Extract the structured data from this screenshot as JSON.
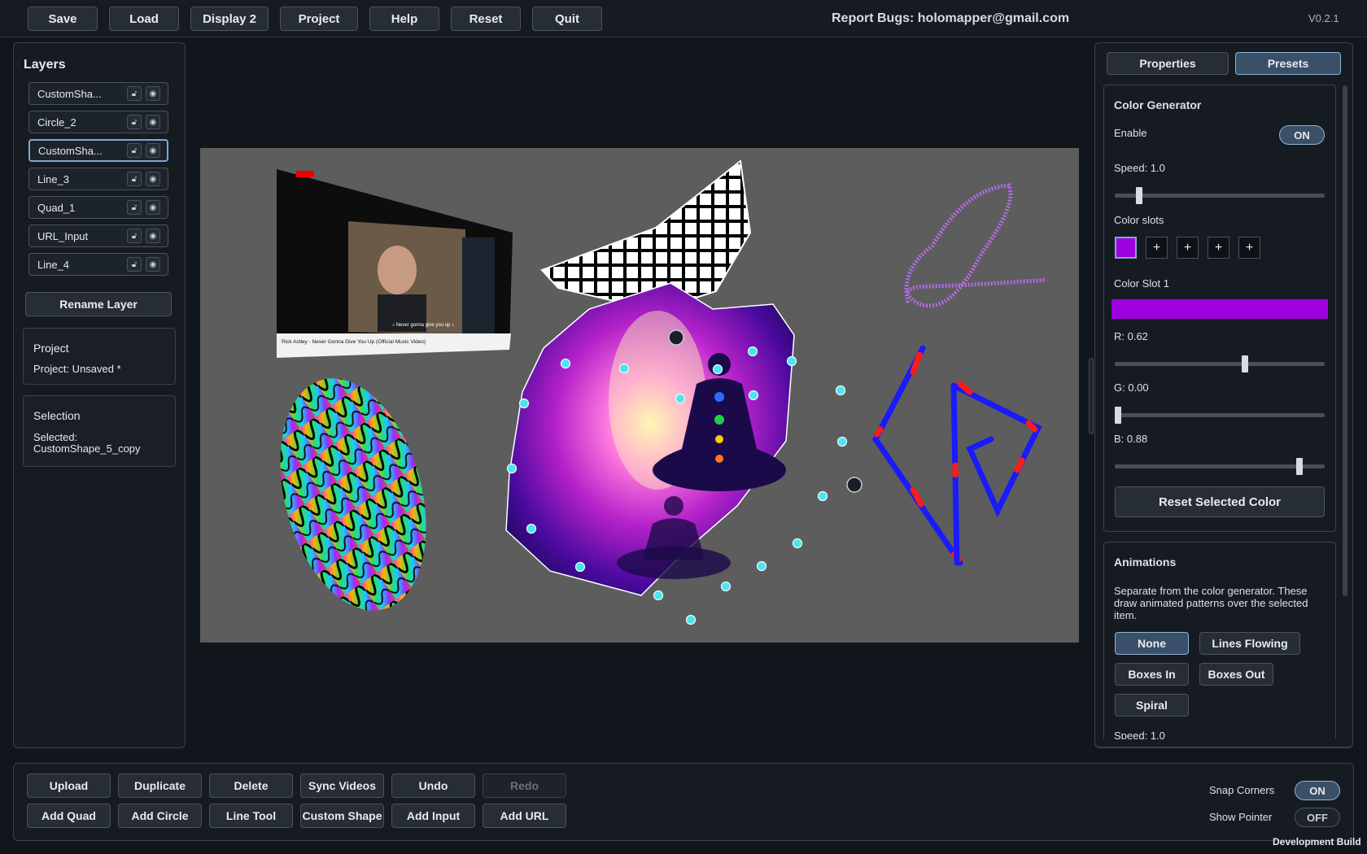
{
  "toolbar": {
    "buttons": [
      "Save",
      "Load",
      "Display 2",
      "Project",
      "Help",
      "Reset",
      "Quit"
    ],
    "report_bugs": "Report Bugs: holomapper@gmail.com",
    "version": "V0.2.1"
  },
  "layers": {
    "title": "Layers",
    "items": [
      "CustomSha...",
      "Circle_2",
      "CustomSha...",
      "Line_3",
      "Quad_1",
      "URL_Input",
      "Line_4"
    ],
    "selected_index": 2,
    "rename_button": "Rename Layer"
  },
  "project": {
    "title": "Project",
    "status": "Project: Unsaved *"
  },
  "selection": {
    "title": "Selection",
    "label": "Selected:",
    "value": "CustomShape_5_copy"
  },
  "canvas": {
    "video_title": "Rick Astley - Never Gonna Give You Up (Official Music Video)",
    "video_caption": "♪ Never gonna give you up ♪",
    "accent_blue": "#1a1aff",
    "accent_red": "#ff1a1a",
    "handle_color": "#4fe3f0"
  },
  "right_panel": {
    "tabs": [
      "Properties",
      "Presets"
    ],
    "active_tab": "Presets",
    "color_generator": {
      "title": "Color Generator",
      "enable_label": "Enable",
      "enable_value": "ON",
      "speed_label": "Speed: 1.0",
      "speed_value": 1.0,
      "slots_label": "Color slots",
      "slot_plus": "+",
      "slot1_color": "#9e00e0",
      "slot1_label": "Color Slot 1",
      "r_label": "R: 0.62",
      "r_value": 0.62,
      "g_label": "G: 0.00",
      "g_value": 0.0,
      "b_label": "B: 0.88",
      "b_value": 0.88,
      "reset_button": "Reset Selected Color"
    },
    "animations": {
      "title": "Animations",
      "description": "Separate from the color generator. These draw animated patterns over the selected item.",
      "buttons": [
        "None",
        "Lines Flowing",
        "Boxes In",
        "Boxes Out",
        "Spiral"
      ],
      "active": "None",
      "speed_label": "Speed: 1.0"
    }
  },
  "bottom": {
    "row1": [
      "Upload",
      "Duplicate",
      "Delete",
      "Sync Videos",
      "Undo",
      "Redo"
    ],
    "row2": [
      "Add Quad",
      "Add Circle",
      "Line Tool",
      "Custom Shape",
      "Add Input",
      "Add URL"
    ],
    "snap_corners_label": "Snap Corners",
    "snap_corners_value": "ON",
    "show_pointer_label": "Show Pointer",
    "show_pointer_value": "OFF",
    "dev_build": "Development Build"
  }
}
